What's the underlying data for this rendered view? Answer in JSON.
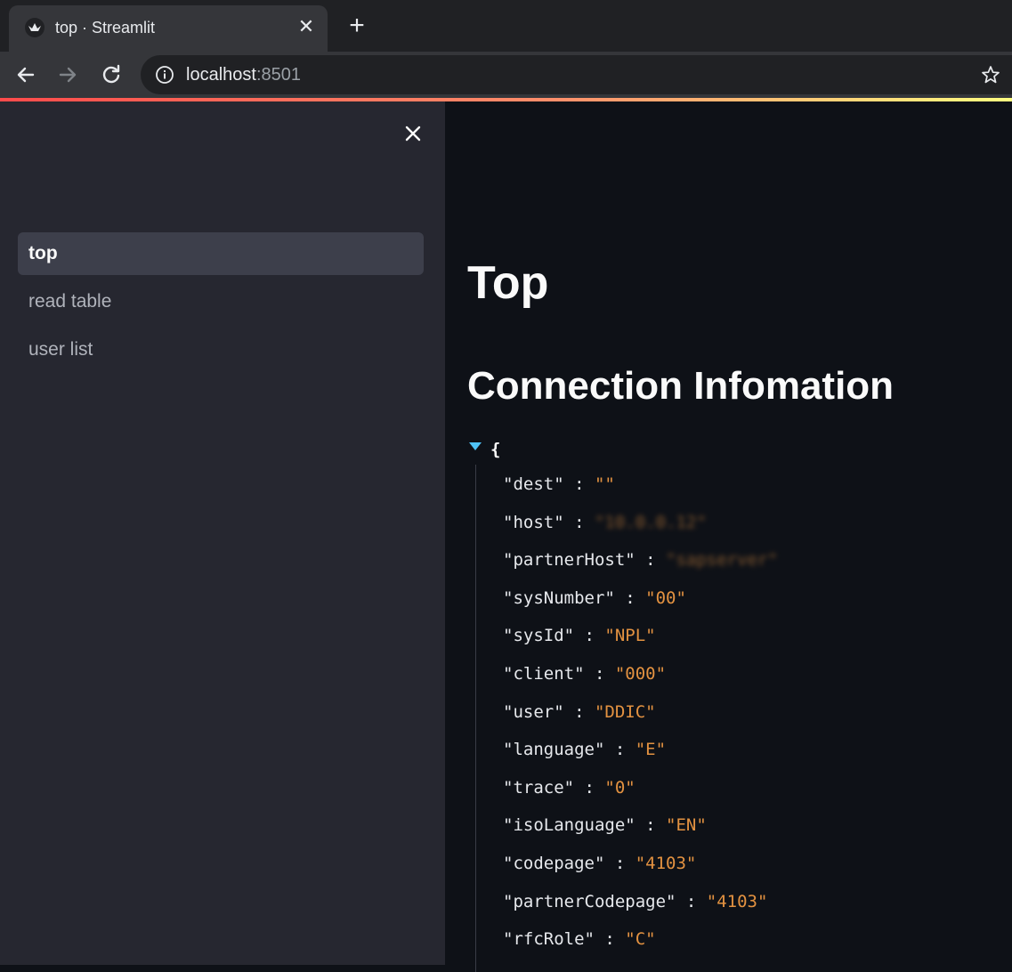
{
  "browser": {
    "tab_title": "top · Streamlit",
    "url_host": "localhost",
    "url_port": ":8501"
  },
  "sidebar": {
    "items": [
      {
        "label": "top",
        "active": true
      },
      {
        "label": "read table",
        "active": false
      },
      {
        "label": "user list",
        "active": false
      }
    ]
  },
  "main": {
    "title": "Top",
    "section_title": "Connection Infomation",
    "json_open": "{",
    "json": [
      {
        "key": "\"dest\"",
        "value": "\"\"",
        "blurred": false
      },
      {
        "key": "\"host\"",
        "value": "\"10.0.0.12\"",
        "blurred": true
      },
      {
        "key": "\"partnerHost\"",
        "value": "\"sapserver\"",
        "blurred": true
      },
      {
        "key": "\"sysNumber\"",
        "value": "\"00\"",
        "blurred": false
      },
      {
        "key": "\"sysId\"",
        "value": "\"NPL\"",
        "blurred": false
      },
      {
        "key": "\"client\"",
        "value": "\"000\"",
        "blurred": false
      },
      {
        "key": "\"user\"",
        "value": "\"DDIC\"",
        "blurred": false
      },
      {
        "key": "\"language\"",
        "value": "\"E\"",
        "blurred": false
      },
      {
        "key": "\"trace\"",
        "value": "\"0\"",
        "blurred": false
      },
      {
        "key": "\"isoLanguage\"",
        "value": "\"EN\"",
        "blurred": false
      },
      {
        "key": "\"codepage\"",
        "value": "\"4103\"",
        "blurred": false
      },
      {
        "key": "\"partnerCodepage\"",
        "value": "\"4103\"",
        "blurred": false
      },
      {
        "key": "\"rfcRole\"",
        "value": "\"C\"",
        "blurred": false
      }
    ]
  },
  "colors": {
    "accent_red": "#ff4b4b",
    "sidebar_bg": "#262730",
    "main_bg": "#0e1117",
    "json_value": "#e39241"
  },
  "icons": [
    "streamlit-crown-icon",
    "close-icon",
    "plus-icon",
    "back-arrow-icon",
    "forward-arrow-icon",
    "reload-icon",
    "info-icon",
    "star-icon",
    "caret-down-icon"
  ]
}
